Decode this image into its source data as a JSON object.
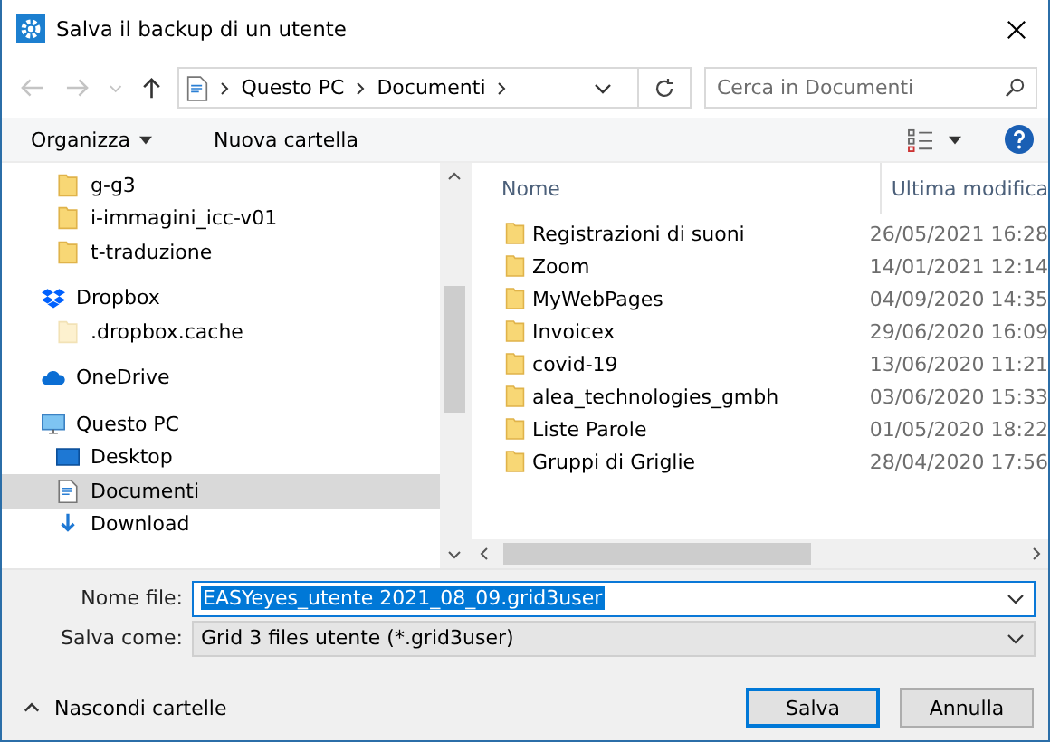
{
  "window": {
    "title": "Salva il backup di un utente"
  },
  "address": {
    "segments": [
      "Questo PC",
      "Documenti"
    ]
  },
  "search": {
    "placeholder": "Cerca in Documenti"
  },
  "toolbar": {
    "buttons": [
      "Organizza",
      "Nuova cartella"
    ]
  },
  "sidebar": {
    "items": [
      {
        "label": "g-g3",
        "kind": "folder",
        "selected": false,
        "hidden": false
      },
      {
        "label": "i-immagini_icc-v01",
        "kind": "folder",
        "selected": false,
        "hidden": false
      },
      {
        "label": "t-traduzione",
        "kind": "folder",
        "selected": false,
        "hidden": false
      },
      {
        "label": "Dropbox",
        "kind": "dropbox",
        "selected": false,
        "children": [
          {
            "label": ".dropbox.cache",
            "kind": "folder",
            "selected": false,
            "hidden": true
          }
        ]
      },
      {
        "label": "OneDrive",
        "kind": "cloud",
        "selected": false
      },
      {
        "label": "Questo PC",
        "kind": "pc",
        "selected": false,
        "children": [
          {
            "label": "Desktop",
            "kind": "desktop",
            "selected": false
          },
          {
            "label": "Documenti",
            "kind": "document",
            "selected": true
          },
          {
            "label": "Download",
            "kind": "download",
            "selected": false
          }
        ]
      }
    ]
  },
  "table": {
    "columns": [
      "Nome",
      "Ultima modifica"
    ],
    "rows": [
      {
        "name": "Registrazioni di suoni",
        "date": "26/05/2021 16:28"
      },
      {
        "name": "Zoom",
        "date": "14/01/2021 12:14"
      },
      {
        "name": "MyWebPages",
        "date": "04/09/2020 14:35"
      },
      {
        "name": "Invoicex",
        "date": "29/06/2020 16:09"
      },
      {
        "name": "covid-19",
        "date": "13/06/2020 11:21"
      },
      {
        "name": "alea_technologies_gmbh",
        "date": "03/06/2020 15:33"
      },
      {
        "name": "Liste Parole",
        "date": "01/05/2020 18:22"
      },
      {
        "name": "Gruppi di Griglie",
        "date": "28/04/2020 17:56"
      }
    ]
  },
  "form": {
    "filename_label": "Nome file:",
    "filename": "EASYeyes_utente 2021_08_09.grid3user",
    "type_label": "Salva come:",
    "type": "Grid 3 files utente (*.grid3user)"
  },
  "footer": {
    "toggle": "Nascondi cartelle",
    "buttons": [
      "Salva",
      "Annulla"
    ]
  }
}
